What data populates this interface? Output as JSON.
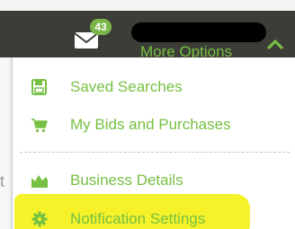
{
  "header": {
    "mail_badge_count": "43",
    "more_options_label": "More Options"
  },
  "dropdown": {
    "items": [
      {
        "label": "Saved Searches",
        "icon": "save-icon"
      },
      {
        "label": "My Bids and Purchases",
        "icon": "cart-icon"
      },
      {
        "label": "Business Details",
        "icon": "bar-chart-icon"
      },
      {
        "label": "Notification Settings",
        "icon": "gear-icon"
      }
    ]
  },
  "background_page": {
    "partial_text": "t"
  },
  "colors": {
    "accent_green": "#76c043",
    "header_bg": "#3d3d38",
    "badge_green": "#7ab648",
    "highlight_yellow": "#f5f22a"
  }
}
